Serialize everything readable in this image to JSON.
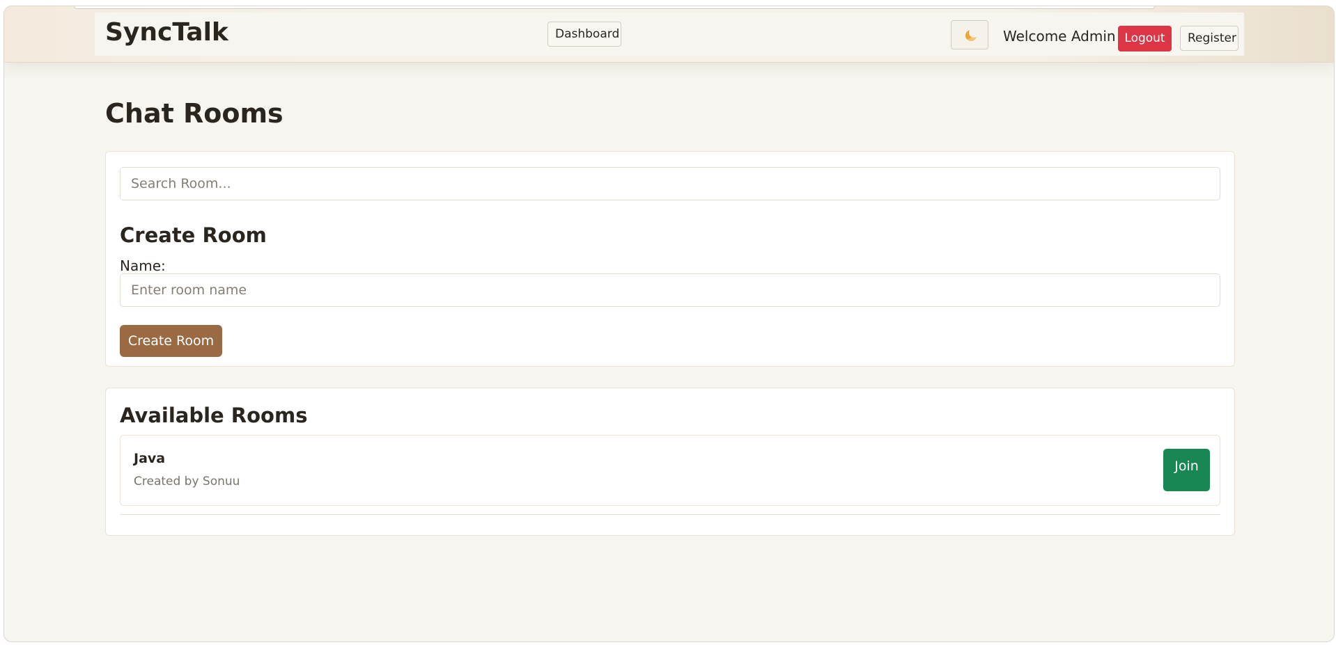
{
  "navbar": {
    "brand": "SyncTalk",
    "dashboard_label": "Dashboard",
    "theme_icon": "moon-icon",
    "welcome_text": "Welcome Admin",
    "logout_label": "Logout",
    "register_label": "Register"
  },
  "page": {
    "title": "Chat Rooms"
  },
  "search": {
    "placeholder": "Search Room...",
    "value": ""
  },
  "create_room": {
    "title": "Create Room",
    "name_label": "Name:",
    "name_placeholder": "Enter room name",
    "submit_label": "Create Room"
  },
  "rooms": {
    "title": "Available Rooms",
    "items": [
      {
        "name": "Java",
        "creator": "Created by Sonuu",
        "join_label": "Join"
      }
    ]
  },
  "colors": {
    "logout": "#dc3545",
    "create": "#9a6a43",
    "join": "#198754",
    "background": "#f7f5f0"
  }
}
